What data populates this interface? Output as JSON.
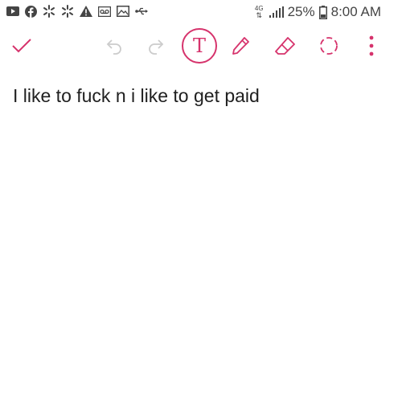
{
  "status_bar": {
    "battery_percent": "25%",
    "time": "8:00 AM",
    "network_label": "4G",
    "notification_icons": [
      "youtube-icon",
      "facebook-icon",
      "walmart-spark-icon",
      "walmart-spark-icon",
      "warning-icon",
      "voicemail-icon",
      "image-icon",
      "usb-icon"
    ]
  },
  "toolbar": {
    "tools": [
      "check-icon",
      "undo-icon",
      "redo-icon",
      "text-tool-icon",
      "pen-icon",
      "eraser-icon",
      "lasso-select-icon",
      "more-options-icon"
    ],
    "active_tool": "text-tool-icon",
    "text_tool_letter": "T",
    "accent_color": "#d6336c",
    "disabled_color": "#cccccc"
  },
  "note": {
    "text": "I like to fuck n i like to get paid"
  }
}
